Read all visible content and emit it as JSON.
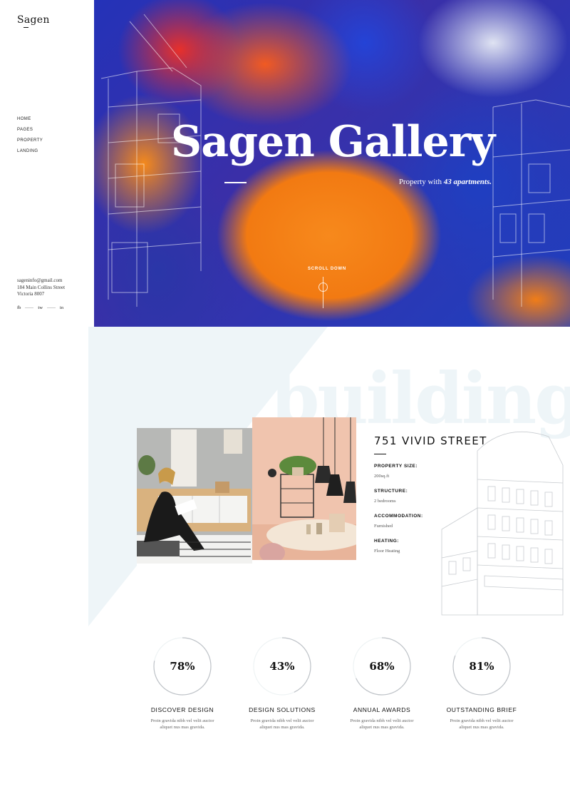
{
  "sidebar": {
    "logo": "Sagen",
    "nav": [
      "HOME",
      "PAGES",
      "PROPERTY",
      "LANDING"
    ],
    "contact": [
      "sageninfo@gmail.com",
      "184 Main Collins Street",
      "Victoria 8007"
    ],
    "social": [
      "fb",
      "tw",
      "in"
    ]
  },
  "hero": {
    "title": "Sagen Gallery",
    "subtitle_prefix": "Property with ",
    "subtitle_em": "43 apartments.",
    "scroll_label": "SCROLL DOWN"
  },
  "building": {
    "background_word": "building",
    "title": "751 VIVID STREET",
    "details": [
      {
        "label": "PROPERTY SIZE:",
        "value": "200sq.ft"
      },
      {
        "label": "STRUCTURE:",
        "value": "2 bedrooms"
      },
      {
        "label": "ACCOMMODATION:",
        "value": "Furnished"
      },
      {
        "label": "HEATING:",
        "value": "Floor Heating"
      }
    ]
  },
  "stats": [
    {
      "value": "78%",
      "percent": 78,
      "title": "DISCOVER DESIGN",
      "desc": "Proin gravida nibh vel velit auctor aliquet nus mas gravida."
    },
    {
      "value": "43%",
      "percent": 43,
      "title": "DESIGN SOLUTIONS",
      "desc": "Proin gravida nibh vel velit auctor aliquet nus mas gravida."
    },
    {
      "value": "68%",
      "percent": 68,
      "title": "ANNUAL AWARDS",
      "desc": "Proin gravida nibh vel velit auctor aliquet nus mas gravida."
    },
    {
      "value": "81%",
      "percent": 81,
      "title": "OUTSTANDING BRIEF",
      "desc": "Proin gravida nibh vel velit auctor aliquet nus mas gravida."
    }
  ],
  "colors": {
    "accent_light": "#eef5f8",
    "ring_active": "#bfc3c8",
    "ring_track": "#eef3f4"
  }
}
